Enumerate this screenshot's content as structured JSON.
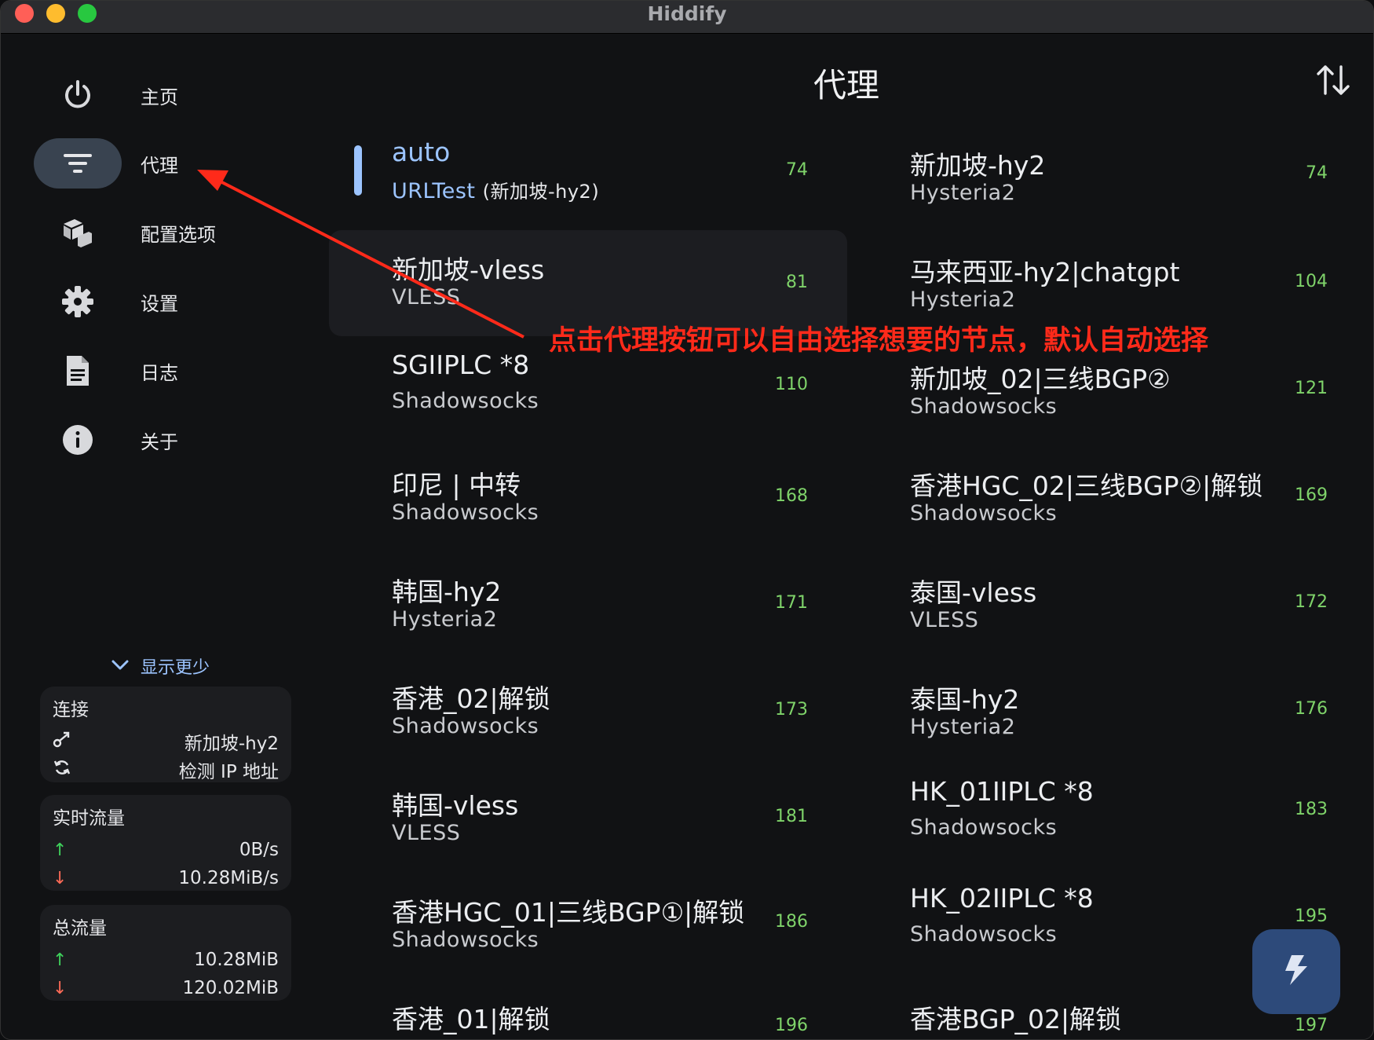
{
  "window": {
    "title": "Hiddify"
  },
  "sidebar": {
    "items": [
      {
        "label": "主页",
        "icon": "power-icon"
      },
      {
        "label": "代理",
        "icon": "filter-lines-icon",
        "active": true
      },
      {
        "label": "配置选项",
        "icon": "boxes-icon"
      },
      {
        "label": "设置",
        "icon": "gear-icon"
      },
      {
        "label": "日志",
        "icon": "document-icon"
      },
      {
        "label": "关于",
        "icon": "info-icon"
      }
    ],
    "show_less": "显示更少",
    "connection": {
      "title": "连接",
      "node": "新加坡-hy2",
      "check_ip": "检测 IP 地址"
    },
    "realtime": {
      "title": "实时流量",
      "up": "0B/s",
      "down": "10.28MiB/s"
    },
    "total": {
      "title": "总流量",
      "up": "10.28MiB",
      "down": "120.02MiB"
    }
  },
  "main": {
    "title": "代理",
    "annotation": "点击代理按钮可以自由选择想要的节点，默认自动选择",
    "proxies_left": [
      {
        "name": "auto",
        "type": "URLTest",
        "sub": "(新加坡-hy2)",
        "delay": "74"
      },
      {
        "name": "新加坡-vless",
        "type": "VLESS",
        "delay": "81"
      },
      {
        "name": "SGIIPLC *8",
        "type": "Shadowsocks",
        "delay": "110"
      },
      {
        "name": "印尼 | 中转",
        "type": "Shadowsocks",
        "delay": "168"
      },
      {
        "name": "韩国-hy2",
        "type": "Hysteria2",
        "delay": "171"
      },
      {
        "name": "香港_02|解锁",
        "type": "Shadowsocks",
        "delay": "173"
      },
      {
        "name": "韩国-vless",
        "type": "VLESS",
        "delay": "181"
      },
      {
        "name": "香港HGC_01|三线BGP①|解锁",
        "type": "Shadowsocks",
        "delay": "186"
      },
      {
        "name": "香港_01|解锁",
        "type": "",
        "delay": "196"
      }
    ],
    "proxies_right": [
      {
        "name": "新加坡-hy2",
        "type": "Hysteria2",
        "delay": "74"
      },
      {
        "name": "马来西亚-hy2|chatgpt",
        "type": "Hysteria2",
        "delay": "104"
      },
      {
        "name": "新加坡_02|三线BGP②",
        "type": "Shadowsocks",
        "delay": "121"
      },
      {
        "name": "香港HGC_02|三线BGP②|解锁",
        "type": "Shadowsocks",
        "delay": "169"
      },
      {
        "name": "泰国-vless",
        "type": "VLESS",
        "delay": "172"
      },
      {
        "name": "泰国-hy2",
        "type": "Hysteria2",
        "delay": "176"
      },
      {
        "name": "HK_01IIPLC *8",
        "type": "Shadowsocks",
        "delay": "183"
      },
      {
        "name": "HK_02IIPLC *8",
        "type": "Shadowsocks",
        "delay": "195"
      },
      {
        "name": "香港BGP_02|解锁",
        "type": "",
        "delay": "197"
      }
    ]
  },
  "colors": {
    "accent": "#9cc4ff",
    "delay": "#7fd36a",
    "annotation": "#ff2a1a"
  }
}
